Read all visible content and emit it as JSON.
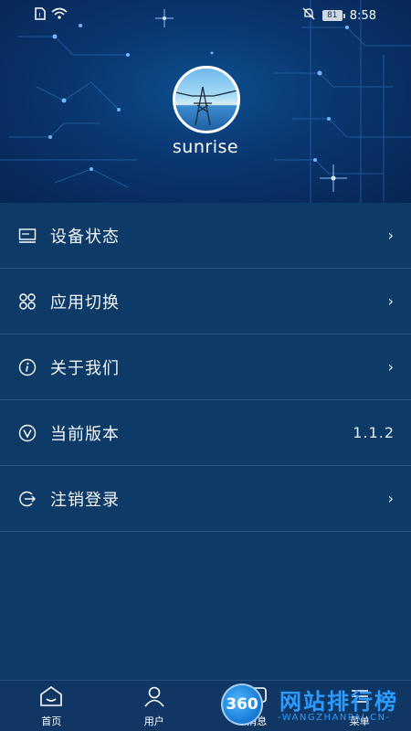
{
  "status_bar": {
    "time": "8:58",
    "battery": "81",
    "icons": [
      "sim-icon",
      "wifi-icon",
      "mute-icon",
      "battery-icon"
    ]
  },
  "profile": {
    "username": "sunrise",
    "avatar_icon": "power-tower-avatar"
  },
  "menu": {
    "items": [
      {
        "label": "设备状态",
        "icon": "device-icon",
        "right": "›"
      },
      {
        "label": "应用切换",
        "icon": "apps-icon",
        "right": "›"
      },
      {
        "label": "关于我们",
        "icon": "info-icon",
        "right": "›"
      },
      {
        "label": "当前版本",
        "icon": "version-icon",
        "right": "1.1.2"
      },
      {
        "label": "注销登录",
        "icon": "logout-icon",
        "right": "›"
      }
    ]
  },
  "tabbar": {
    "tabs": [
      {
        "label": "首页",
        "icon": "home-icon"
      },
      {
        "label": "用户",
        "icon": "user-icon"
      },
      {
        "label": "消息",
        "icon": "message-icon"
      },
      {
        "label": "菜单",
        "icon": "menu-icon"
      }
    ]
  },
  "watermark": {
    "logo": "360",
    "title": "网站排行榜",
    "subtitle": "-WANGZHANPAI.CN-"
  },
  "colors": {
    "background": "#0d3a66",
    "header": "#0a3670",
    "tabbar": "#103764",
    "watermark": "#2b9bff"
  }
}
